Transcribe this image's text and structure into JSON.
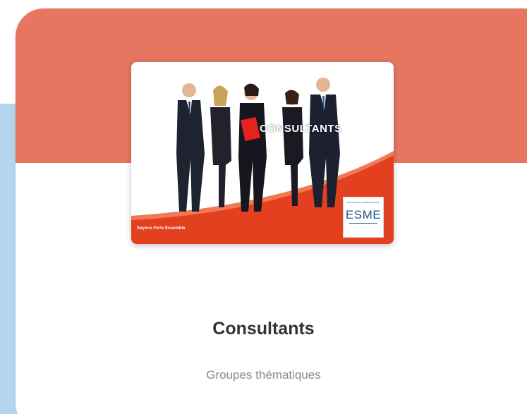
{
  "colors": {
    "header": "#e6765f",
    "backCard": "#b3d6ee",
    "accentRed": "#e2401f"
  },
  "card": {
    "image": {
      "icon": "group-photo-icon",
      "title": "CONSULTANTS",
      "tagline": "Soyons Forts Ensemble",
      "logo": {
        "text": "ESME",
        "small_lines": "ASSOCIATION INTERNATIONALE"
      }
    },
    "title": "Consultants",
    "subtitle": "Groupes thématiques"
  }
}
